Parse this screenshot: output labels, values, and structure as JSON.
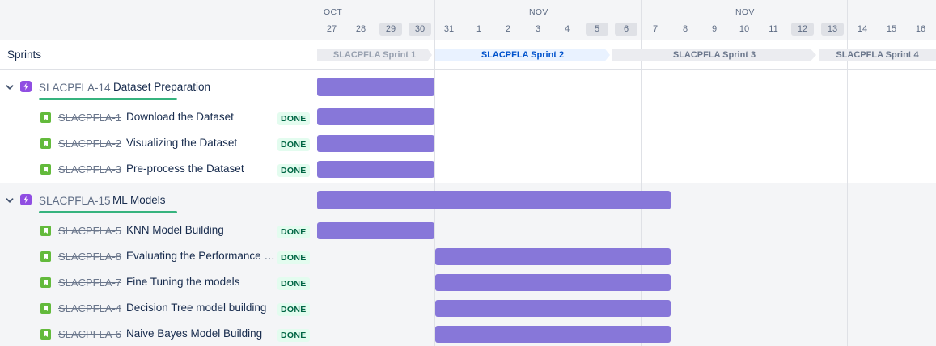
{
  "header": {
    "months": [
      "OCT",
      "NOV",
      "NOV"
    ],
    "days": [
      "27",
      "28",
      "29",
      "30",
      "31",
      "1",
      "2",
      "3",
      "4",
      "5",
      "6",
      "7",
      "8",
      "9",
      "10",
      "11",
      "12",
      "13",
      "14",
      "15",
      "16"
    ]
  },
  "left_panel": {
    "sprints_label": "Sprints"
  },
  "sprints": [
    {
      "name": "SLACPFLA Sprint 1",
      "state": "past"
    },
    {
      "name": "SLACPFLA Sprint 2",
      "state": "active"
    },
    {
      "name": "SLACPFLA Sprint 3",
      "state": "future"
    },
    {
      "name": "SLACPFLA Sprint 4",
      "state": "future"
    }
  ],
  "epics": [
    {
      "key": "SLACPFLA-14",
      "title": "Dataset Preparation",
      "stories": [
        {
          "key": "SLACPFLA-1",
          "title": "Download the Dataset",
          "status": "DONE"
        },
        {
          "key": "SLACPFLA-2",
          "title": "Visualizing the Dataset",
          "status": "DONE"
        },
        {
          "key": "SLACPFLA-3",
          "title": "Pre-process the Dataset",
          "status": "DONE"
        }
      ]
    },
    {
      "key": "SLACPFLA-15",
      "title": "ML Models",
      "stories": [
        {
          "key": "SLACPFLA-5",
          "title": "KNN Model Building",
          "status": "DONE"
        },
        {
          "key": "SLACPFLA-8",
          "title": "Evaluating the Performance of the Model",
          "status": "DONE"
        },
        {
          "key": "SLACPFLA-7",
          "title": "Fine Tuning the models",
          "status": "DONE"
        },
        {
          "key": "SLACPFLA-4",
          "title": "Decision Tree model building",
          "status": "DONE"
        },
        {
          "key": "SLACPFLA-6",
          "title": "Naive Bayes Model Building",
          "status": "DONE"
        }
      ]
    }
  ],
  "colors": {
    "bar": "#8777d9",
    "epic_icon": "#904ee2",
    "story_icon": "#63ba3c",
    "progress": "#36b37e",
    "done_bg": "#e3fcef",
    "done_text": "#006644"
  },
  "icons": {
    "collapse": "chevron-down-icon",
    "epic": "epic-lightning-icon",
    "story": "story-bookmark-icon"
  }
}
